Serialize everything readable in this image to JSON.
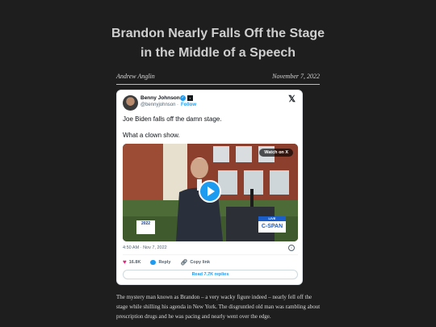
{
  "article": {
    "title_line1": "Brandon Nearly Falls Off the Stage",
    "title_line2": "in the Middle of a Speech",
    "author": "Andrew Anglin",
    "date": "November 7, 2022",
    "body": "The mystery man known as Brandon – a very wacky figure indeed – nearly fell off the stage while shilling his agenda in New York. The disgruntled old man was rambling about prescription drugs and he was pacing and nearly went over the edge."
  },
  "tweet": {
    "author_name": "Benny Johnson",
    "handle": "@bennyjohnson",
    "dot": "·",
    "follow_label": "Follow",
    "verified_icon": "check-badge",
    "x_logo": "𝕏",
    "text_line1": "Joe Biden falls off the damn stage.",
    "text_line2": "What a clown show.",
    "media": {
      "watch_on_label": "Watch on X",
      "event_logo_text": "2022",
      "live_label": "LIVE",
      "cspan_label": "C-SPAN"
    },
    "timestamp": "4:50 AM · Nov 7, 2022",
    "likes": "16.8K",
    "reply_label": "Reply",
    "copy_link_label": "Copy link",
    "read_replies_label": "Read 7.7K replies"
  },
  "colors": {
    "background": "#1e1e1f",
    "x_blue": "#1d9bf0",
    "like_pink": "#f91880",
    "cspan_blue": "#1b5ec9"
  }
}
